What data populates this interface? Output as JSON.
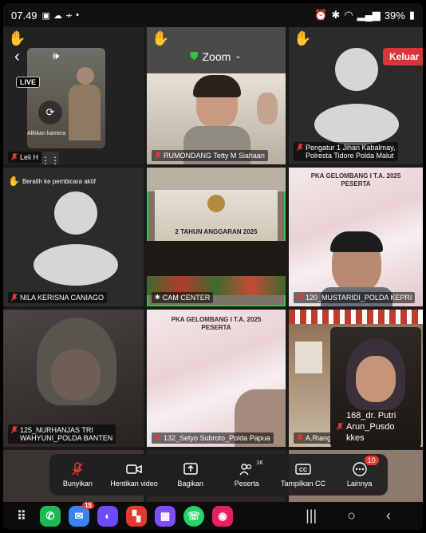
{
  "status": {
    "time": "07.49",
    "battery": "39%"
  },
  "header": {
    "app_title": "Zoom",
    "leave_label": "Keluar"
  },
  "self_view": {
    "live_label": "LIVE",
    "switch_camera_label": "Alihkan kamera"
  },
  "switch_speaker_label": "Beralih ke pembicara aktif",
  "participants": [
    {
      "name": "Leli H"
    },
    {
      "name": "RUMONDANG Tetty M Siahaan"
    },
    {
      "name_line1": "Pengatur 1 Jihan Kabalmay,",
      "name_line2": "Polresta Tidore Polda Malut"
    },
    {
      "name": "NILA KERISNA CANIAGO"
    },
    {
      "name": "CAM CENTER"
    },
    {
      "name": "120_MUSTARIDI_POLDA KEPRI"
    },
    {
      "name_line1": "125_NURHANJAS TRI",
      "name_line2": "WAHYUNI_POLDA BANTEN"
    },
    {
      "name": "132_Setyo Subroto_Polda Papua"
    },
    {
      "name": "A.Riang"
    },
    {
      "name_line1": "168_dr. Putri",
      "name_line2": "Arun_Pusdo",
      "name_line3": "kkes"
    }
  ],
  "banners": {
    "pka_line1": "PKA GELOMBANG I T.A. 2025",
    "pka_line2": "PESERTA",
    "stage_line": "2 TAHUN ANGGARAN 2025"
  },
  "toolbar": {
    "unmute_label": "Bunyikan",
    "stop_video_label": "Hentikan video",
    "share_label": "Bagikan",
    "participants_label": "Peserta",
    "participants_count": "1K",
    "captions_label": "Tampilkan CC",
    "more_label": "Lainnya",
    "more_badge": "10"
  },
  "navbar": {
    "messages_badge": "15"
  },
  "colors": {
    "leave": "#d9343a",
    "active_speaker": "#35c14a",
    "badge": "#e53935"
  }
}
